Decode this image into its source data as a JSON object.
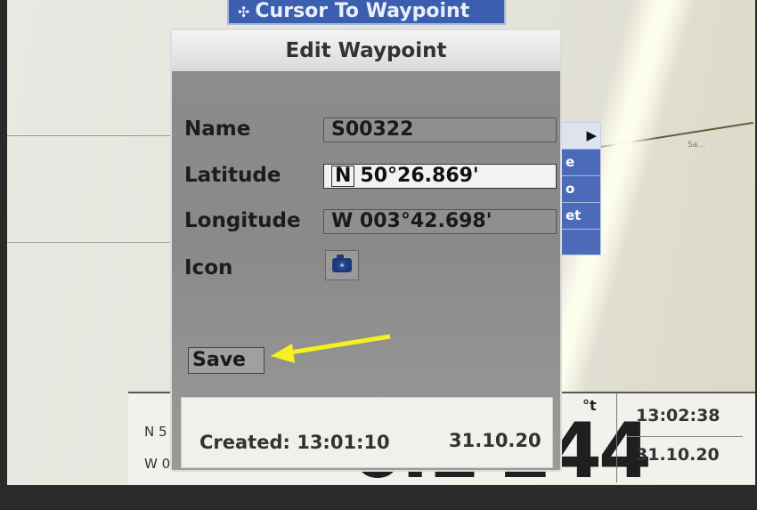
{
  "top_menu": {
    "icon": "waypoint-icon",
    "label": "Cursor To Waypoint"
  },
  "side_menu": {
    "items": [
      "▶",
      "e",
      "o",
      "et"
    ]
  },
  "background_map": {
    "map_label": "Sa..."
  },
  "bottom_bar": {
    "lat_prefix": "N 5",
    "lon_prefix": "W 0(",
    "big_value": "0.1 244",
    "unit": "°t",
    "time": "13:02:38",
    "date": "31.10.20"
  },
  "dialog": {
    "title": "Edit Waypoint",
    "fields": {
      "name": {
        "label": "Name",
        "value": "S00322"
      },
      "latitude": {
        "label": "Latitude",
        "hemisphere": "N",
        "value": "50°26.869'"
      },
      "longitude": {
        "label": "Longitude",
        "value": "W 003°42.698'"
      },
      "icon": {
        "label": "Icon",
        "icon_name": "camera-icon"
      }
    },
    "save_label": "Save",
    "footer": {
      "created": "Created: 13:01:10",
      "date": "31.10.20"
    }
  },
  "annotation": {
    "arrow_color": "#f5f020"
  }
}
